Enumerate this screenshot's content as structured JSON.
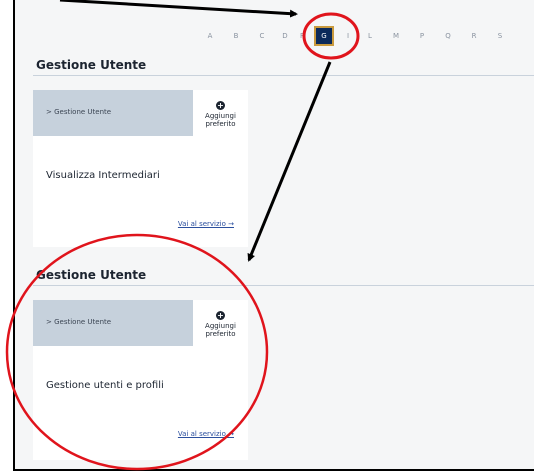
{
  "alphabet": {
    "letters": [
      "A",
      "B",
      "C",
      "D",
      "F",
      "G",
      "I",
      "L",
      "M",
      "P",
      "Q",
      "R",
      "S"
    ],
    "active": "G"
  },
  "sections": [
    {
      "title": "Gestione Utente",
      "card": {
        "breadcrumb": "> Gestione Utente",
        "favorite_line1": "Aggiungi",
        "favorite_line2": "preferito",
        "title": "Visualizza Intermediari",
        "link": "Vai al servizio →"
      }
    },
    {
      "title": "Gestione Utente",
      "card": {
        "breadcrumb": "> Gestione Utente",
        "favorite_line1": "Aggiungi",
        "favorite_line2": "preferito",
        "title": "Gestione utenti e profili",
        "link": "Vai al servizio →"
      }
    }
  ],
  "colors": {
    "active_letter_bg": "#0b2a5b",
    "active_letter_border": "#c99a3e",
    "breadcrumb_bg": "#c6d1dc",
    "link": "#2b4f9e",
    "annotation": "#e0141c"
  }
}
